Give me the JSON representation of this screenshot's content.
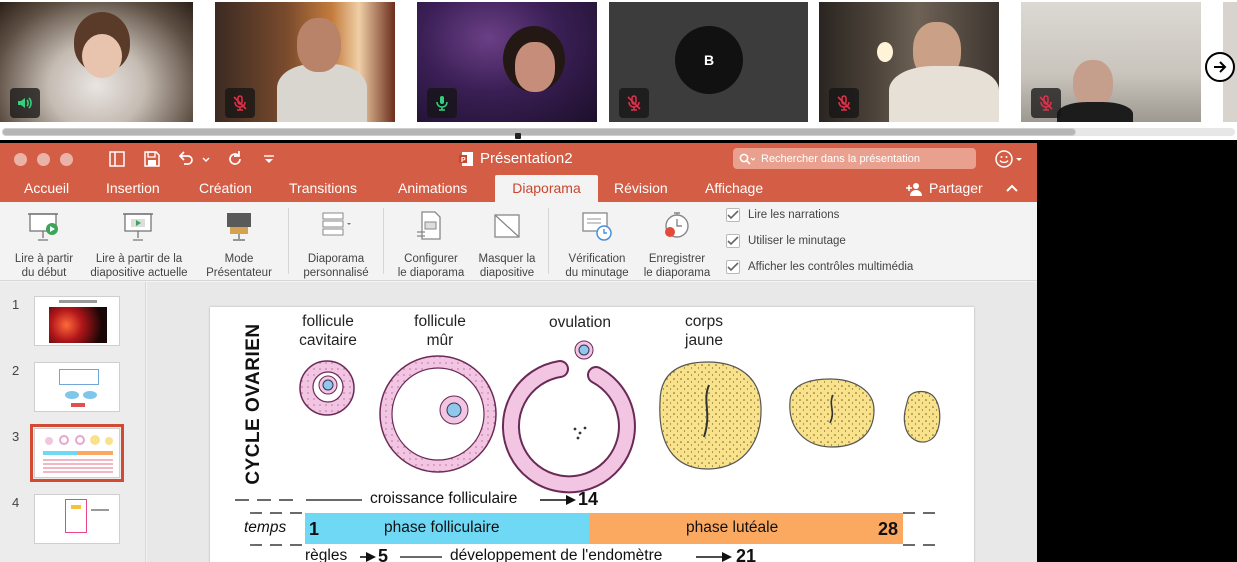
{
  "video": {
    "participants": [
      {
        "mic": "on",
        "avatar": ""
      },
      {
        "mic": "muted",
        "avatar": ""
      },
      {
        "mic": "on",
        "avatar": ""
      },
      {
        "mic": "muted",
        "avatar": "B"
      },
      {
        "mic": "muted",
        "avatar": ""
      },
      {
        "mic": "muted",
        "avatar": ""
      }
    ]
  },
  "window": {
    "title": "Présentation2",
    "search_placeholder": "Rechercher dans la présentation"
  },
  "tabs": [
    {
      "label": "Accueil",
      "active": false
    },
    {
      "label": "Insertion",
      "active": false
    },
    {
      "label": "Création",
      "active": false
    },
    {
      "label": "Transitions",
      "active": false
    },
    {
      "label": "Animations",
      "active": false
    },
    {
      "label": "Diaporama",
      "active": true
    },
    {
      "label": "Révision",
      "active": false
    },
    {
      "label": "Affichage",
      "active": false
    }
  ],
  "share_label": "Partager",
  "ribbon": {
    "buttons": [
      {
        "line1": "Lire à partir",
        "line2": "du début"
      },
      {
        "line1": "Lire à partir de la",
        "line2": "diapositive actuelle"
      },
      {
        "line1": "Mode",
        "line2": "Présentateur"
      },
      {
        "line1": "Diaporama",
        "line2": "personnalisé"
      },
      {
        "line1": "Configurer",
        "line2": "le diaporama"
      },
      {
        "line1": "Masquer la",
        "line2": "diapositive"
      },
      {
        "line1": "Vérification",
        "line2": "du minutage"
      },
      {
        "line1": "Enregistrer",
        "line2": "le diaporama"
      }
    ],
    "checkboxes": [
      {
        "label": "Lire les narrations",
        "checked": true
      },
      {
        "label": "Utiliser le minutage",
        "checked": true
      },
      {
        "label": "Afficher les contrôles multimédia",
        "checked": true
      }
    ]
  },
  "slides_pane": {
    "items": [
      {
        "number": "1",
        "selected": false
      },
      {
        "number": "2",
        "selected": false
      },
      {
        "number": "3",
        "selected": true
      },
      {
        "number": "4",
        "selected": false
      }
    ]
  },
  "slide": {
    "vertical_title": "CYCLE OVARIEN",
    "labels": {
      "follicule_cavitaire_1": "follicule",
      "follicule_cavitaire_2": "cavitaire",
      "follicule_mur_1": "follicule",
      "follicule_mur_2": "mûr",
      "ovulation": "ovulation",
      "corps_jaune_1": "corps",
      "corps_jaune_2": "jaune"
    },
    "croissance": "croissance folliculaire",
    "croissance_day": "14",
    "temps": "temps",
    "day_start": "1",
    "phase_folliculaire": "phase folliculaire",
    "phase_luteale": "phase lutéale",
    "day_end": "28",
    "regles": "règles",
    "regles_day": "5",
    "endometre": "développement de l'endomètre",
    "endometre_day": "21",
    "colors": {
      "follicular": "#6fd8f5",
      "luteal": "#fba960",
      "follicle": "#f2c6e2",
      "corpus": "#f9e28c"
    }
  }
}
